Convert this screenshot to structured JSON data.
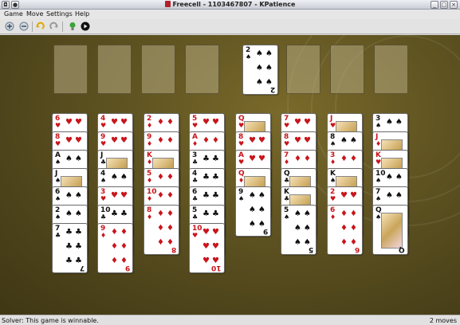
{
  "window": {
    "title": "Freecell - 1103467807 - KPatience",
    "buttons": [
      "menu",
      "sticky",
      "minimize",
      "maximize",
      "close"
    ]
  },
  "menu": {
    "items": [
      "Game",
      "Move",
      "Settings",
      "Help"
    ]
  },
  "toolbar": {
    "tools": [
      {
        "name": "new-game-icon",
        "color": "#6b7b8e"
      },
      {
        "name": "restart-icon",
        "color": "#6b7b8e"
      },
      {
        "name": "undo-icon",
        "color": "#e0a800"
      },
      {
        "name": "redo-icon",
        "color": "#9a9a9a"
      },
      {
        "name": "hint-icon",
        "color": "#2f8f2f"
      },
      {
        "name": "demo-icon",
        "color": "#111111"
      }
    ]
  },
  "freecells": [
    null,
    null,
    null,
    null
  ],
  "foundations": [
    {
      "rank": "2",
      "suit": "♠",
      "color": "black"
    },
    null,
    null,
    null
  ],
  "tableau": [
    [
      {
        "rank": "6",
        "suit": "♥",
        "color": "red"
      },
      {
        "rank": "8",
        "suit": "♥",
        "color": "red"
      },
      {
        "rank": "A",
        "suit": "♠",
        "color": "black"
      },
      {
        "rank": "J",
        "suit": "♠",
        "color": "black",
        "face": true
      },
      {
        "rank": "6",
        "suit": "♠",
        "color": "black"
      },
      {
        "rank": "2",
        "suit": "♠",
        "color": "black"
      },
      {
        "rank": "7",
        "suit": "♣",
        "color": "black"
      }
    ],
    [
      {
        "rank": "4",
        "suit": "♥",
        "color": "red"
      },
      {
        "rank": "9",
        "suit": "♥",
        "color": "red"
      },
      {
        "rank": "J",
        "suit": "♣",
        "color": "black",
        "face": true
      },
      {
        "rank": "4",
        "suit": "♠",
        "color": "black"
      },
      {
        "rank": "3",
        "suit": "♥",
        "color": "red"
      },
      {
        "rank": "10",
        "suit": "♣",
        "color": "black"
      },
      {
        "rank": "9",
        "suit": "♦",
        "color": "red"
      }
    ],
    [
      {
        "rank": "2",
        "suit": "♦",
        "color": "red"
      },
      {
        "rank": "9",
        "suit": "♦",
        "color": "red"
      },
      {
        "rank": "K",
        "suit": "♦",
        "color": "red",
        "face": true
      },
      {
        "rank": "5",
        "suit": "♦",
        "color": "red"
      },
      {
        "rank": "10",
        "suit": "♦",
        "color": "red"
      },
      {
        "rank": "8",
        "suit": "♦",
        "color": "red"
      }
    ],
    [
      {
        "rank": "5",
        "suit": "♥",
        "color": "red"
      },
      {
        "rank": "A",
        "suit": "♦",
        "color": "red"
      },
      {
        "rank": "3",
        "suit": "♣",
        "color": "black"
      },
      {
        "rank": "4",
        "suit": "♣",
        "color": "black"
      },
      {
        "rank": "6",
        "suit": "♣",
        "color": "black"
      },
      {
        "rank": "5",
        "suit": "♣",
        "color": "black"
      },
      {
        "rank": "10",
        "suit": "♥",
        "color": "red"
      }
    ],
    [
      {
        "rank": "Q",
        "suit": "♥",
        "color": "red",
        "face": true
      },
      {
        "rank": "8",
        "suit": "♥",
        "color": "red"
      },
      {
        "rank": "A",
        "suit": "♥",
        "color": "red"
      },
      {
        "rank": "Q",
        "suit": "♦",
        "color": "red",
        "face": true
      },
      {
        "rank": "9",
        "suit": "♠",
        "color": "black"
      }
    ],
    [
      {
        "rank": "7",
        "suit": "♥",
        "color": "red"
      },
      {
        "rank": "8",
        "suit": "♥",
        "color": "red"
      },
      {
        "rank": "7",
        "suit": "♦",
        "color": "red"
      },
      {
        "rank": "Q",
        "suit": "♣",
        "color": "black",
        "face": true
      },
      {
        "rank": "K",
        "suit": "♣",
        "color": "black",
        "face": true
      },
      {
        "rank": "5",
        "suit": "♠",
        "color": "black"
      }
    ],
    [
      {
        "rank": "J",
        "suit": "♥",
        "color": "red",
        "face": true
      },
      {
        "rank": "8",
        "suit": "♠",
        "color": "black"
      },
      {
        "rank": "3",
        "suit": "♦",
        "color": "red"
      },
      {
        "rank": "K",
        "suit": "♠",
        "color": "black",
        "face": true
      },
      {
        "rank": "2",
        "suit": "♥",
        "color": "red"
      },
      {
        "rank": "6",
        "suit": "♦",
        "color": "red"
      }
    ],
    [
      {
        "rank": "3",
        "suit": "♠",
        "color": "black"
      },
      {
        "rank": "J",
        "suit": "♦",
        "color": "red",
        "face": true
      },
      {
        "rank": "K",
        "suit": "♥",
        "color": "red",
        "face": true
      },
      {
        "rank": "10",
        "suit": "♠",
        "color": "black"
      },
      {
        "rank": "7",
        "suit": "♠",
        "color": "black"
      },
      {
        "rank": "Q",
        "suit": "♠",
        "color": "black",
        "face": true
      }
    ]
  ],
  "status": {
    "message": "Solver: This game is winnable.",
    "moves": "2 moves"
  }
}
